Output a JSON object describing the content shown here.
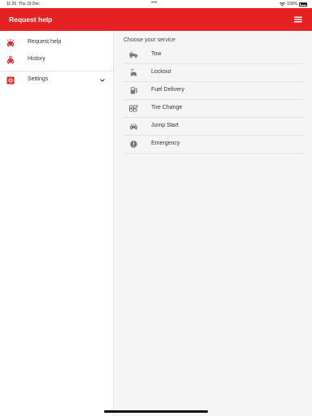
{
  "status_bar": {
    "time": "11:26",
    "date": "Thu 19 Dec",
    "dots": "•••",
    "battery": "100%",
    "wifi_icon": "wifi-icon",
    "battery_icon": "battery-icon"
  },
  "app_bar": {
    "title": "Request help",
    "menu_icon": "hamburger-menu-icon",
    "background": "#e52121",
    "text_color": "#ffffff"
  },
  "sidebar": {
    "items": [
      {
        "label": "Request help",
        "icon": "car-alert-icon"
      },
      {
        "label": "History",
        "icon": "car-history-icon"
      },
      {
        "label": "Settings",
        "icon": "settings-box-icon",
        "expand_icon": "chevron-down-icon"
      }
    ],
    "accent_color": "#e52121"
  },
  "main": {
    "section_title": "Choose your service",
    "services": [
      {
        "label": "Tow",
        "icon": "tow-truck-icon"
      },
      {
        "label": "Lockout",
        "icon": "lockout-icon"
      },
      {
        "label": "Fuel Delivery",
        "icon": "fuel-pump-icon"
      },
      {
        "label": "Tire Change",
        "icon": "tire-change-icon"
      },
      {
        "label": "Jump Start",
        "icon": "car-battery-icon"
      },
      {
        "label": "Emergency",
        "icon": "emergency-alert-icon"
      }
    ],
    "icon_color": "#757575",
    "background": "#f5f5f5"
  }
}
